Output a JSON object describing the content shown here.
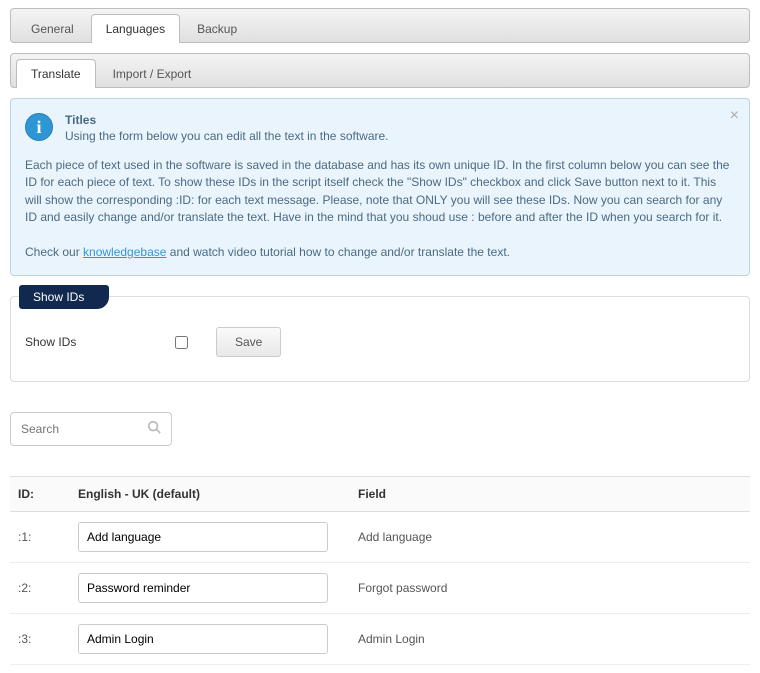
{
  "tabs_primary": [
    {
      "label": "General",
      "active": false
    },
    {
      "label": "Languages",
      "active": true
    },
    {
      "label": "Backup",
      "active": false
    }
  ],
  "tabs_secondary": [
    {
      "label": "Translate",
      "active": true
    },
    {
      "label": "Import / Export",
      "active": false
    }
  ],
  "info": {
    "title": "Titles",
    "subtitle": "Using the form below you can edit all the text in the software.",
    "body1": "Each piece of text used in the software is saved in the database and has its own unique ID. In the first column below you can see the ID for each piece of text. To show these IDs in the script itself check the \"Show IDs\" checkbox and click Save button next to it. This will show the corresponding :ID: for each text message. Please, note that ONLY you will see these IDs. Now you can search for any ID and easily change and/or translate the text. Have in the mind that you shoud use : before and after the ID when you search for it.",
    "body2_pre": "Check our ",
    "body2_link": "knowledgebase",
    "body2_post": " and watch video tutorial how to change and/or translate the text."
  },
  "show_ids": {
    "legend": "Show IDs",
    "label": "Show IDs",
    "save": "Save"
  },
  "search": {
    "placeholder": "Search"
  },
  "table": {
    "headers": {
      "id": "ID:",
      "english": "English - UK (default)",
      "field": "Field"
    },
    "rows": [
      {
        "id": ":1:",
        "english": "Add language",
        "field": "Add language"
      },
      {
        "id": ":2:",
        "english": "Password reminder",
        "field": "Forgot password"
      },
      {
        "id": ":3:",
        "english": "Admin Login",
        "field": "Admin Login"
      }
    ]
  }
}
